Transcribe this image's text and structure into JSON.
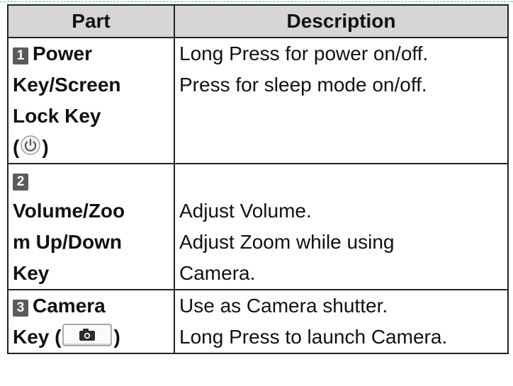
{
  "table": {
    "header": {
      "part": "Part",
      "description": "Description"
    },
    "rows": [
      {
        "number": "1",
        "part_lines": [
          "Power",
          "Key/Screen",
          "Lock Key",
          "("
        ],
        "part_close": ")",
        "icon": "power-icon",
        "description_lines": [
          "Long Press for power on/off.",
          "Press for sleep mode on/off."
        ]
      },
      {
        "number": "2",
        "part_lines": [
          "",
          "Volume/Zoo",
          "m Up/Down",
          "Key"
        ],
        "description_lines": [
          "",
          "Adjust Volume.",
          "Adjust Zoom while using",
          "Camera."
        ]
      },
      {
        "number": "3",
        "part_lines": [
          "Camera",
          "Key ("
        ],
        "part_close": ")",
        "icon": "camera-icon",
        "description_lines": [
          "Use as Camera shutter.",
          "Long Press to launch Camera."
        ]
      }
    ]
  },
  "colors": {
    "header_bg": "#d6d6d6",
    "badge_bg": "#5b5b5b",
    "border": "#222222"
  }
}
